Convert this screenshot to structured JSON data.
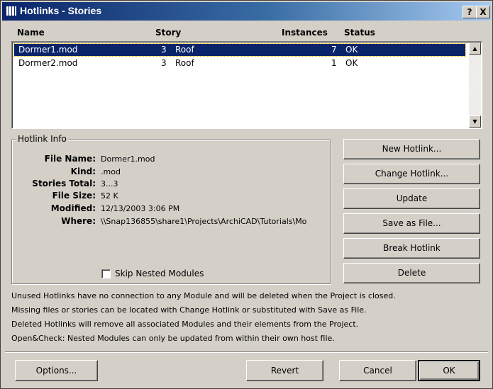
{
  "window": {
    "title": "Hotlinks - Stories",
    "help_label": "?",
    "close_label": "X"
  },
  "list": {
    "columns": [
      "Name",
      "Story",
      "Instances",
      "Status"
    ],
    "rows": [
      {
        "name": "Dormer1.mod",
        "story_num": "3",
        "story_name": "Roof",
        "instances": "7",
        "status": "OK",
        "selected": true
      },
      {
        "name": "Dormer2.mod",
        "story_num": "3",
        "story_name": "Roof",
        "instances": "1",
        "status": "OK",
        "selected": false
      }
    ],
    "scroll_up": "▲",
    "scroll_down": "▼"
  },
  "info": {
    "legend": "Hotlink Info",
    "labels": {
      "file_name": "File Name:",
      "kind": "Kind:",
      "stories_total": "Stories Total:",
      "file_size": "File Size:",
      "modified": "Modified:",
      "where": "Where:"
    },
    "values": {
      "file_name": "Dormer1.mod",
      "kind": ".mod",
      "stories_total": "3...3",
      "file_size": "52 K",
      "modified": "12/13/2003 3:06 PM",
      "where": "\\\\Snap136855\\share1\\Projects\\ArchiCAD\\Tutorials\\Mo"
    },
    "skip_nested_label": "Skip Nested Modules",
    "skip_nested_checked": false
  },
  "actions": {
    "new_hotlink": "New Hotlink...",
    "change_hotlink": "Change Hotlink...",
    "update": "Update",
    "save_as_file": "Save as File...",
    "break_hotlink": "Break Hotlink",
    "delete": "Delete"
  },
  "notes": [
    "Unused Hotlinks have no connection to any Module and will be deleted when the Project is closed.",
    "Missing files or stories can be located with Change Hotlink or substituted with Save as File.",
    "Deleted Hotlinks will remove all associated Modules and their elements from the Project.",
    "Open&Check: Nested Modules can only be updated from within their own host file."
  ],
  "footer": {
    "options": "Options...",
    "revert": "Revert",
    "cancel": "Cancel",
    "ok": "OK"
  },
  "colors": {
    "title_start": "#0a246a",
    "title_end": "#a6caf0",
    "selection": "#0a246a",
    "dialog_bg": "#d4d0c8"
  }
}
